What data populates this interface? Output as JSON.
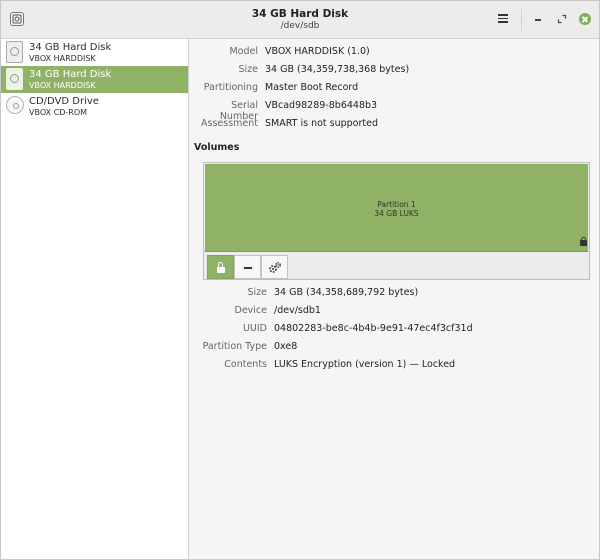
{
  "window": {
    "title": "34 GB Hard Disk",
    "subtitle": "/dev/sdb"
  },
  "sidebar": {
    "items": [
      {
        "name": "34 GB Hard Disk",
        "sub": "VBOX HARDDISK",
        "icon": "hard-disk-icon",
        "selected": false
      },
      {
        "name": "34 GB Hard Disk",
        "sub": "VBOX HARDDISK",
        "icon": "hard-disk-icon",
        "selected": true
      },
      {
        "name": "CD/DVD Drive",
        "sub": "VBOX CD-ROM",
        "icon": "optical-disc-icon",
        "selected": false
      }
    ]
  },
  "disk": {
    "model_label": "Model",
    "model": "VBOX HARDDISK (1.0)",
    "size_label": "Size",
    "size": "34 GB (34,359,738,368 bytes)",
    "partitioning_label": "Partitioning",
    "partitioning": "Master Boot Record",
    "serial_label": "Serial Number",
    "serial": "VBcad98289-8b6448b3",
    "assessment_label": "Assessment",
    "assessment": "SMART is not supported"
  },
  "volumes": {
    "heading": "Volumes",
    "partition": {
      "name": "Partition 1",
      "size": "34 GB LUKS"
    }
  },
  "partition_details": {
    "size_label": "Size",
    "size": "34 GB (34,358,689,792 bytes)",
    "device_label": "Device",
    "device": "/dev/sdb1",
    "uuid_label": "UUID",
    "uuid": "04802283-be8c-4b4b-9e91-47ec4f3cf31d",
    "type_label": "Partition Type",
    "type": "0xe8",
    "contents_label": "Contents",
    "contents": "LUKS Encryption (version 1) — Locked"
  },
  "colors": {
    "accent": "#8fb266",
    "close": "#7fb054"
  }
}
